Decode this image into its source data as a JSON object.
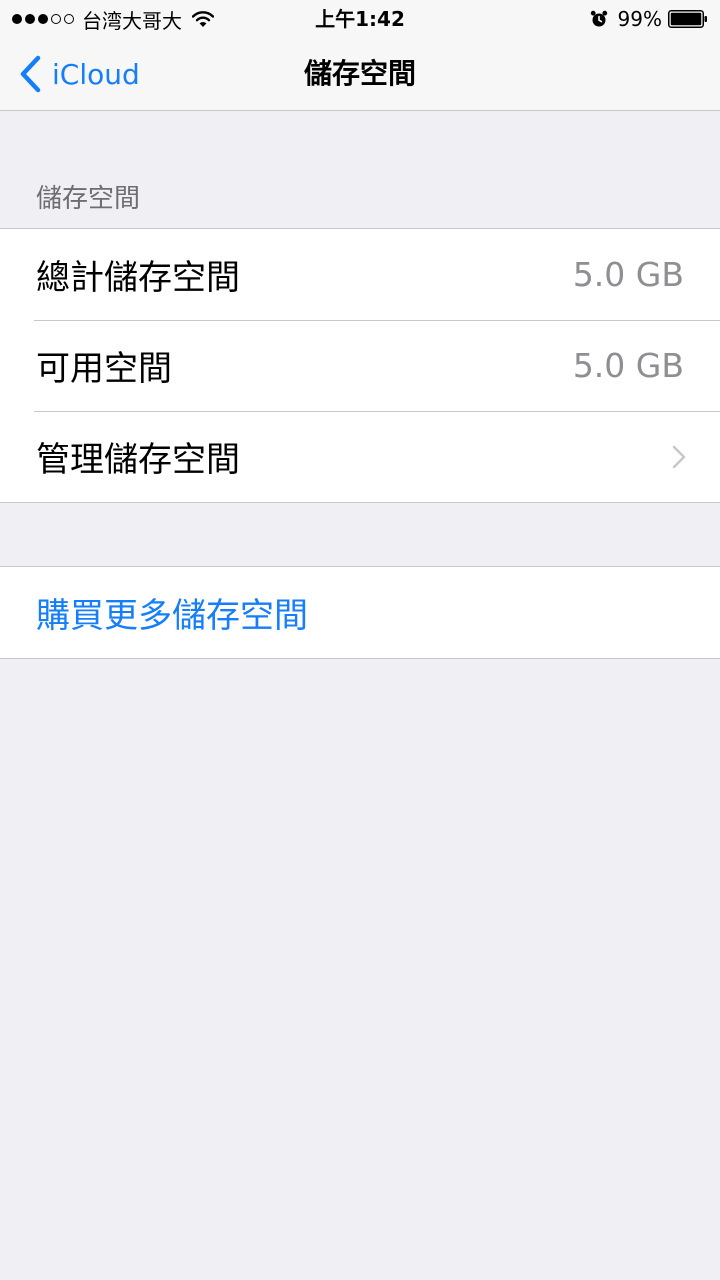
{
  "status_bar": {
    "carrier": "台湾大哥大",
    "time": "上午1:42",
    "battery": "99%",
    "signal_strength": 3,
    "signal_max": 5
  },
  "nav": {
    "back_label": "iCloud",
    "title": "儲存空間"
  },
  "section": {
    "header": "儲存空間",
    "rows": [
      {
        "label": "總計儲存空間",
        "value": "5.0 GB"
      },
      {
        "label": "可用空間",
        "value": "5.0 GB"
      },
      {
        "label": "管理儲存空間"
      }
    ]
  },
  "purchase": {
    "label": "購買更多儲存空間"
  },
  "colors": {
    "accent": "#157efb",
    "background": "#efeff4",
    "secondary_text": "#8e8e93"
  }
}
